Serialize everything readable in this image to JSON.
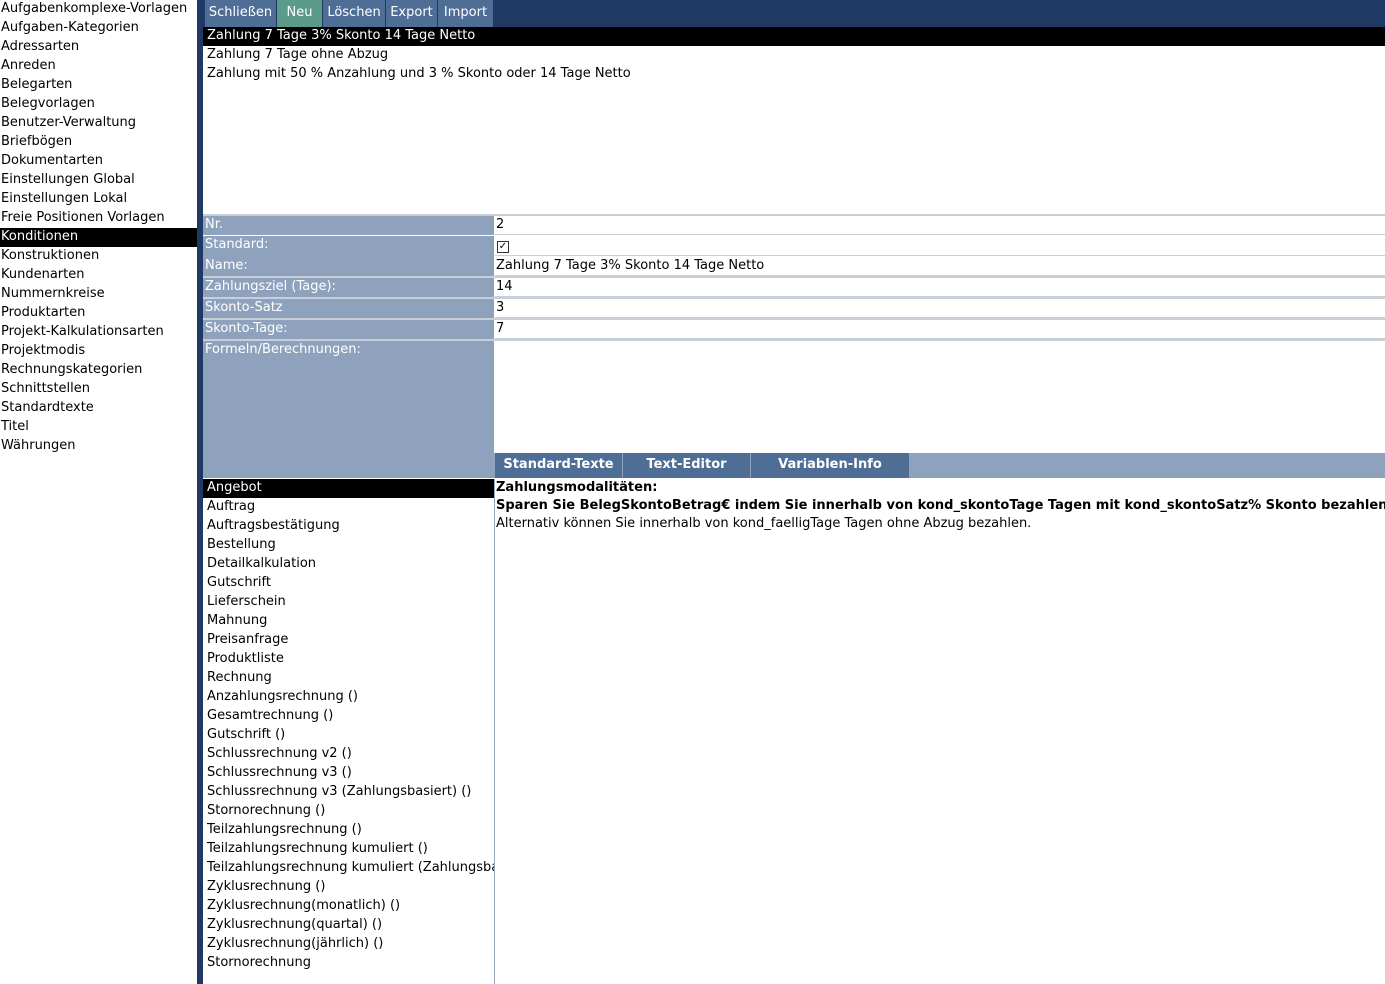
{
  "sidebar": {
    "items": [
      "Aufgabenkomplexe-Vorlagen",
      "Aufgaben-Kategorien",
      "Adressarten",
      "Anreden",
      "Belegarten",
      "Belegvorlagen",
      "Benutzer-Verwaltung",
      "Briefbögen",
      "Dokumentarten",
      "Einstellungen Global",
      "Einstellungen Lokal",
      "Freie Positionen Vorlagen",
      "Konditionen",
      "Konstruktionen",
      "Kundenarten",
      "Nummernkreise",
      "Produktarten",
      "Projekt-Kalkulationsarten",
      "Projektmodis",
      "Rechnungskategorien",
      "Schnittstellen",
      "Standardtexte",
      "Titel",
      "Währungen"
    ],
    "selected": "Konditionen"
  },
  "toolbar": {
    "close": "Schließen",
    "new": "Neu",
    "delete": "Löschen",
    "export": "Export",
    "import": "Import"
  },
  "conditions": [
    "Zahlung 7 Tage 3% Skonto 14 Tage Netto",
    "Zahlung 7 Tage ohne Abzug",
    "Zahlung mit 50 % Anzahlung und 3 % Skonto oder 14 Tage Netto"
  ],
  "form": {
    "nr_label": "Nr.",
    "nr_value": "2",
    "standard_label": "Standard:",
    "standard_checked": true,
    "name_label": "Name:",
    "name_value": "Zahlung 7 Tage 3% Skonto 14 Tage Netto",
    "zahlungsziel_label": "Zahlungsziel (Tage):",
    "zahlungsziel_value": "14",
    "skonto_satz_label": "Skonto-Satz",
    "skonto_satz_value": "3",
    "skonto_tage_label": "Skonto-Tage:",
    "skonto_tage_value": "7",
    "formeln_label": "Formeln/Berechnungen:",
    "formeln_value": ""
  },
  "tabs": [
    "Standard-Texte",
    "Text-Editor",
    "Variablen-Info"
  ],
  "doc_types": [
    "Angebot",
    "Auftrag",
    "Auftragsbestätigung",
    "Bestellung",
    "Detailkalkulation",
    "Gutschrift",
    "Lieferschein",
    "Mahnung",
    "Preisanfrage",
    "Produktliste",
    "Rechnung",
    "Anzahlungsrechnung ()",
    "Gesamtrechnung ()",
    "Gutschrift ()",
    "Schlussrechnung v2 ()",
    "Schlussrechnung v3 ()",
    "Schlussrechnung v3 (Zahlungsbasiert) ()",
    "Stornorechnung ()",
    "Teilzahlungsrechnung ()",
    "Teilzahlungsrechnung kumuliert ()",
    "Teilzahlungsrechnung kumuliert (Zahlungsbasi",
    "Zyklusrechnung ()",
    "Zyklusrechnung(monatlich) ()",
    "Zyklusrechnung(quartal) ()",
    "Zyklusrechnung(jährlich) ()",
    "Stornorechnung"
  ],
  "selected_doc_type": "Angebot",
  "editor": {
    "line1": "Zahlungsmodalitäten:",
    "line2": "Sparen Sie BelegSkontoBetrag€ indem Sie innerhalb von kond_skontoTage Tagen mit kond_skontoSatz% Skonto bezahlen!",
    "line3": "Alternativ können Sie innerhalb von kond_faelligTage Tagen ohne Abzug bezahlen."
  },
  "colors": {
    "navy": "#1f3864",
    "toolbar_button": "#4f6e96",
    "new_button": "#5b9b8a",
    "label_bg": "#8ea2bd",
    "selected_row": "#000000"
  }
}
